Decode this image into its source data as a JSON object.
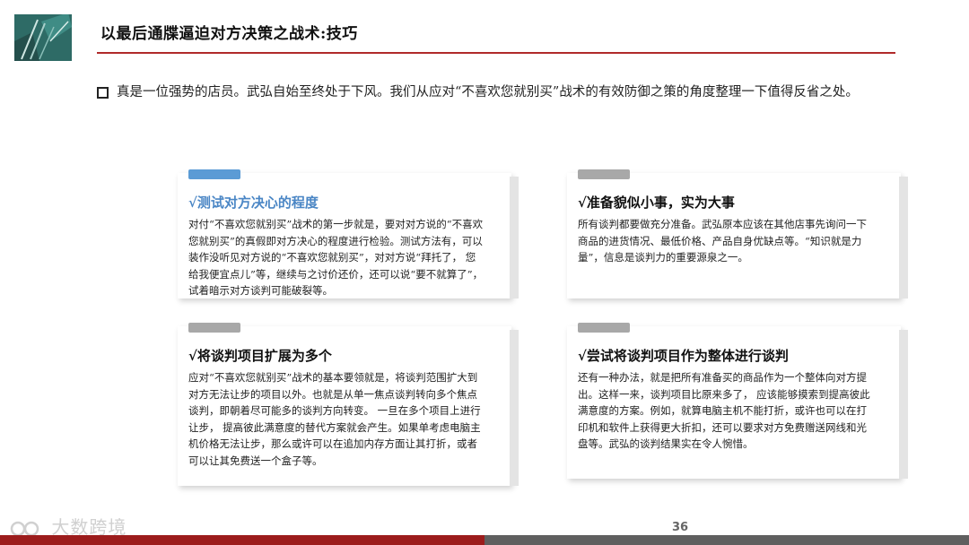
{
  "header": {
    "title": "以最后通牒逼迫对方决策之战术:技巧"
  },
  "intro": {
    "text": "真是一位强势的店员。武弘自始至终处于下风。我们从应对“不喜欢您就别买”战术的有效防御之策的角度整理一下值得反省之处。"
  },
  "cards": [
    {
      "title": "√测试对方决心的程度",
      "body": "对付“不喜欢您就别买”战术的第一步就是，要对对方说的“不喜欢您就别买”的真假即对方决心的程度进行检验。测试方法有，可以装作没听见对方说的“不喜欢您就别买”，对对方说“拜托了， 您给我便宜点儿”等，继续与之讨价还价，还可以说“要不就算了”，试着暗示对方谈判可能破裂等。"
    },
    {
      "title": "√准备貌似小事，实为大事",
      "body": "所有谈判都要做充分准备。武弘原本应该在其他店事先询问一下商品的进货情况、最低价格、产品自身优缺点等。“知识就是力量”，信息是谈判力的重要源泉之一。"
    },
    {
      "title": "√将谈判项目扩展为多个",
      "body": "应对“不喜欢您就别买”战术的基本要领就是，将谈判范围扩大到对方无法让步的项目以外。也就是从单一焦点谈判转向多个焦点谈判，即朝着尽可能多的谈判方向转变。 一旦在多个项目上进行让步， 提高彼此满意度的替代方案就会产生。如果单考虑电脑主机价格无法让步，那么或许可以在追加内存方面让其打折，或者可以让其免费送一个盒子等。"
    },
    {
      "title": "√尝试将谈判项目作为整体进行谈判",
      "body": "还有一种办法，就是把所有准备买的商品作为一个整体向对方提出。这样一来，谈判项目比原来多了， 应该能够摸索到提高彼此满意度的方案。例如，就算电脑主机不能打折，或许也可以在打印机和软件上获得更大折扣，还可以要求对方免费赠送网线和光盘等。武弘的谈判结果实在令人惋惜。"
    }
  ],
  "footer": {
    "page_number": "36",
    "watermark": "大数跨境"
  },
  "colors": {
    "accent_red": "#b02a2a",
    "accent_blue": "#4a86c5",
    "footer_red": "#9c1c1c",
    "footer_gray": "#5f5f5f"
  }
}
